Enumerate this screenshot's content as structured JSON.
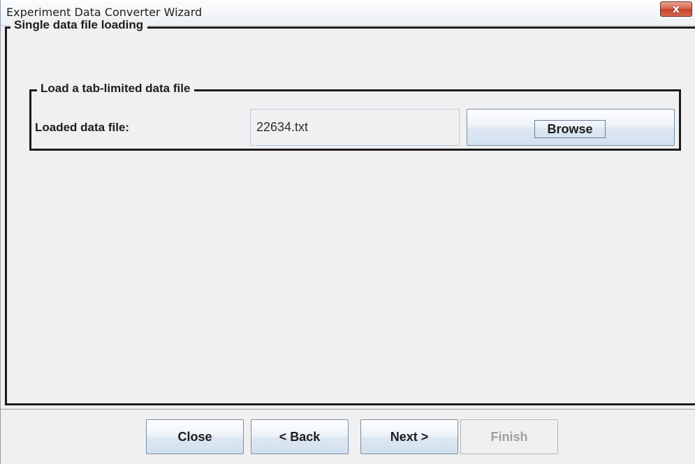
{
  "window": {
    "title": "Experiment Data Converter Wizard",
    "close_glyph": "x"
  },
  "section": {
    "title": "Single data file loading"
  },
  "subsection": {
    "title": "Load a tab-limited data file",
    "field_label": "Loaded data file:",
    "field_value": "22634.txt",
    "browse_label": "Browse"
  },
  "footer": {
    "close_label": "Close",
    "back_label": "< Back",
    "next_label": "Next >",
    "finish_label": "Finish"
  },
  "colors": {
    "close_button": "#c9533a",
    "frame_border": "#1b1b1b",
    "field_border": "#b8cde4",
    "disabled_text": "#a0a0a0"
  }
}
